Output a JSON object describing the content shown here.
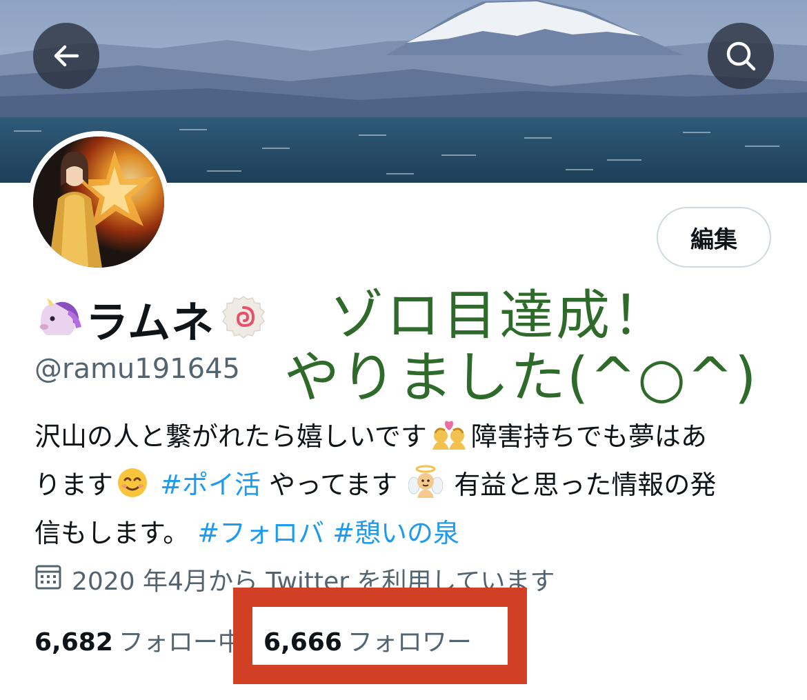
{
  "header": {
    "back_icon": "arrow-left-icon",
    "search_icon": "search-icon"
  },
  "profile": {
    "edit_label": "編集",
    "name_prefix_emoji": "unicorn",
    "name": "ラムネ",
    "name_suffix_emoji": "fish-cake",
    "handle": "@ramu191645"
  },
  "overlay": {
    "line1": "ゾロ目達成！",
    "line2": "やりました(^○^)"
  },
  "bio": {
    "part1": "沢山の人と繋がれたら嬉しいです",
    "part2": "障害持ちでも夢はあ",
    "part3": "ります",
    "hashtag1": "#ポイ活",
    "part4": " やってます",
    "part5": " 有益と思った情報の発",
    "part6": "信もします。 ",
    "hashtag2": "#フォロバ",
    "hashtag3": "#憩いの泉"
  },
  "joined": {
    "text": "2020 年4月から Twitter を利用しています",
    "icon": "calendar-icon"
  },
  "stats": {
    "following_count": "6,682",
    "following_label": "フォロー中",
    "followers_count": "6,666",
    "followers_label": "フォロワー"
  },
  "colors": {
    "accent": "#1d9bf0",
    "overlay_text": "#2e6b2a",
    "highlight": "#d13f25"
  }
}
